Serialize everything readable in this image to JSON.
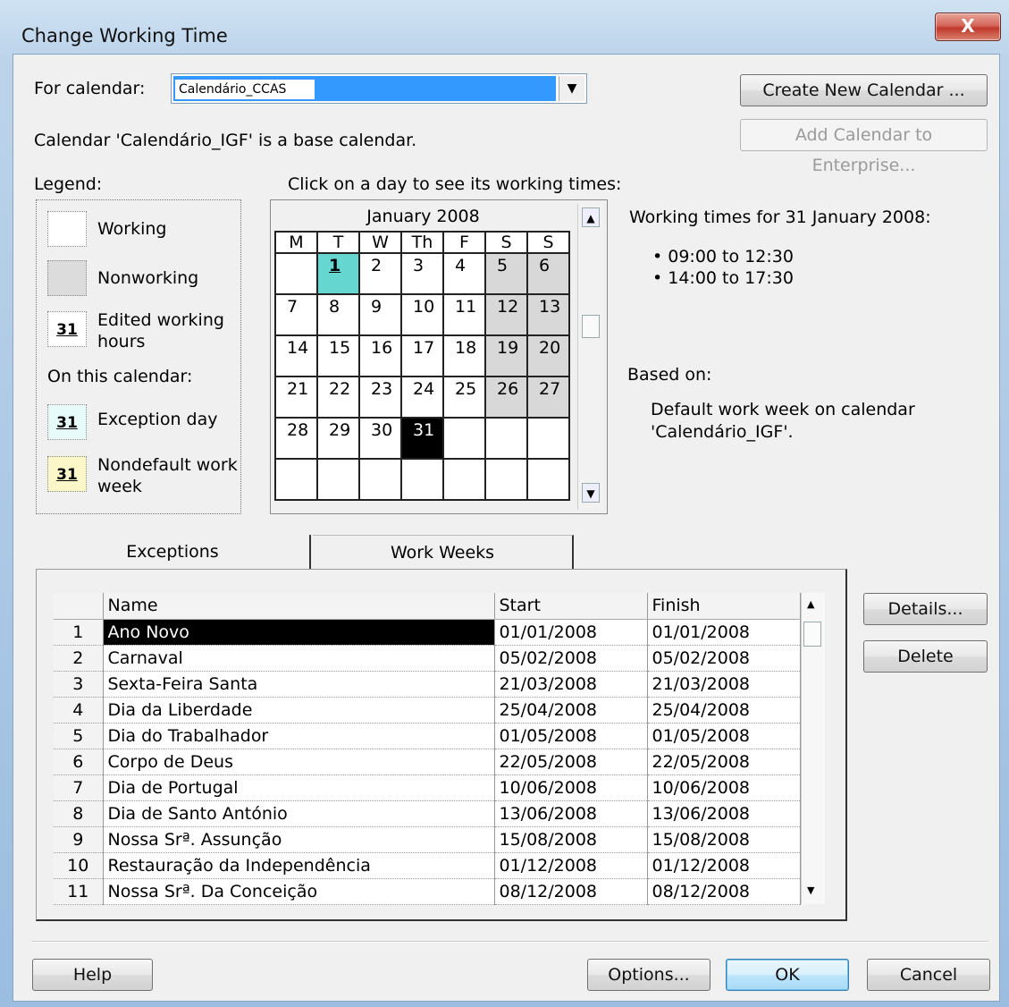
{
  "window": {
    "title": "Change Working Time",
    "close_glyph": "X"
  },
  "for_calendar": {
    "label": "For calendar:",
    "value": "Calendário_CCAS"
  },
  "base_calendar_note": "Calendar 'Calendário_IGF' is a base calendar.",
  "buttons": {
    "create_new_calendar": "Create New Calendar ...",
    "add_to_enterprise": "Add Calendar to Enterprise...",
    "details": "Details...",
    "delete": "Delete",
    "help": "Help",
    "options": "Options...",
    "ok": "OK",
    "cancel": "Cancel"
  },
  "legend": {
    "title": "Legend:",
    "working": "Working",
    "nonworking": "Nonworking",
    "edited_working_hours": "Edited working hours",
    "on_this_calendar": "On this calendar:",
    "exception_day": "Exception day",
    "nondefault_work_week": "Nondefault work week",
    "swatch_number": "31"
  },
  "calendar": {
    "instruction": "Click on a day to see its working times:",
    "month": "January 2008",
    "weekdays": [
      "M",
      "T",
      "W",
      "Th",
      "F",
      "S",
      "S"
    ],
    "weeks": [
      [
        "",
        "1",
        "2",
        "3",
        "4",
        "5",
        "6"
      ],
      [
        "7",
        "8",
        "9",
        "10",
        "11",
        "12",
        "13"
      ],
      [
        "14",
        "15",
        "16",
        "17",
        "18",
        "19",
        "20"
      ],
      [
        "21",
        "22",
        "23",
        "24",
        "25",
        "26",
        "27"
      ],
      [
        "28",
        "29",
        "30",
        "31",
        "",
        "",
        ""
      ],
      [
        "",
        "",
        "",
        "",
        "",
        "",
        ""
      ]
    ]
  },
  "working_times": {
    "heading": "Working times for 31 January 2008:",
    "times": [
      "09:00 to 12:30",
      "14:00 to 17:30"
    ],
    "based_on_label": "Based on:",
    "based_on_text_line1": "Default work week on calendar",
    "based_on_text_line2": "'Calendário_IGF'."
  },
  "tabs": {
    "exceptions": "Exceptions",
    "work_weeks": "Work Weeks"
  },
  "exceptions_table": {
    "headers": [
      "Name",
      "Start",
      "Finish"
    ],
    "rows": [
      [
        "1",
        "Ano Novo",
        "01/01/2008",
        "01/01/2008"
      ],
      [
        "2",
        "Carnaval",
        "05/02/2008",
        "05/02/2008"
      ],
      [
        "3",
        "Sexta-Feira Santa",
        "21/03/2008",
        "21/03/2008"
      ],
      [
        "4",
        "Dia da Liberdade",
        "25/04/2008",
        "25/04/2008"
      ],
      [
        "5",
        "Dia do Trabalhador",
        "01/05/2008",
        "01/05/2008"
      ],
      [
        "6",
        "Corpo de Deus",
        "22/05/2008",
        "22/05/2008"
      ],
      [
        "7",
        "Dia de Portugal",
        "10/06/2008",
        "10/06/2008"
      ],
      [
        "8",
        "Dia de Santo António",
        "13/06/2008",
        "13/06/2008"
      ],
      [
        "9",
        "Nossa Srª. Assunção",
        "15/08/2008",
        "15/08/2008"
      ],
      [
        "10",
        "Restauração da Independência",
        "01/12/2008",
        "01/12/2008"
      ],
      [
        "11",
        "Nossa Srª. Da Conceição",
        "08/12/2008",
        "08/12/2008"
      ]
    ]
  }
}
